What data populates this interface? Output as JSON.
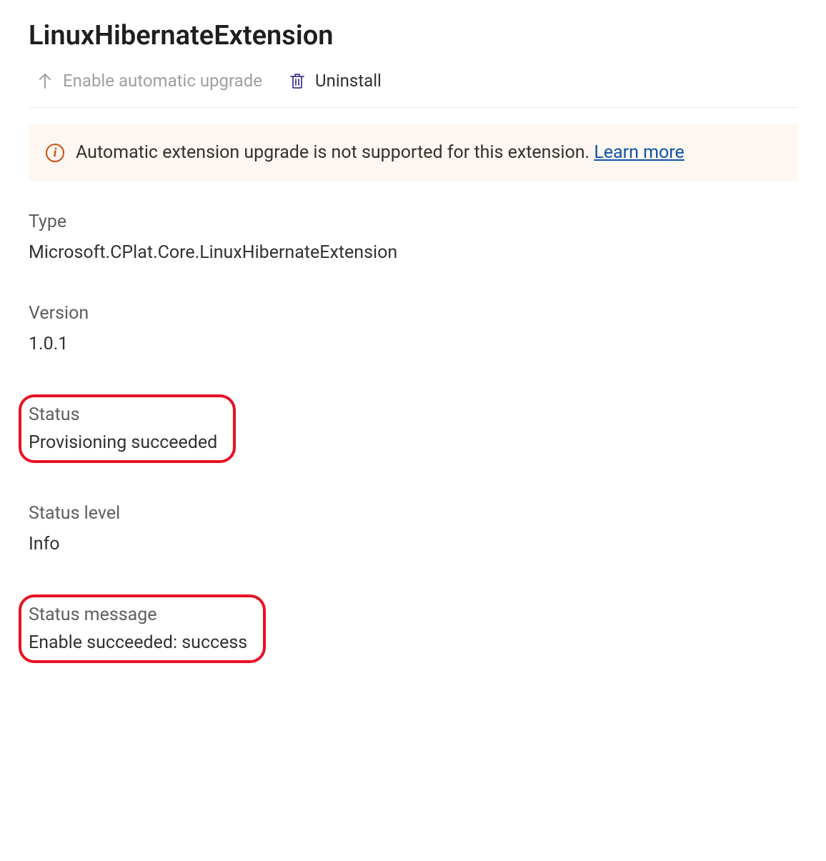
{
  "header": {
    "title": "LinuxHibernateExtension"
  },
  "toolbar": {
    "enable_auto_upgrade": "Enable automatic upgrade",
    "uninstall": "Uninstall"
  },
  "banner": {
    "message": "Automatic extension upgrade is not supported for this extension. ",
    "learn_more": "Learn more"
  },
  "details": {
    "type_label": "Type",
    "type_value": "Microsoft.CPlat.Core.LinuxHibernateExtension",
    "version_label": "Version",
    "version_value": "1.0.1",
    "status_label": "Status",
    "status_value": "Provisioning succeeded",
    "status_level_label": "Status level",
    "status_level_value": "Info",
    "status_message_label": "Status message",
    "status_message_value": "Enable succeeded: success"
  }
}
